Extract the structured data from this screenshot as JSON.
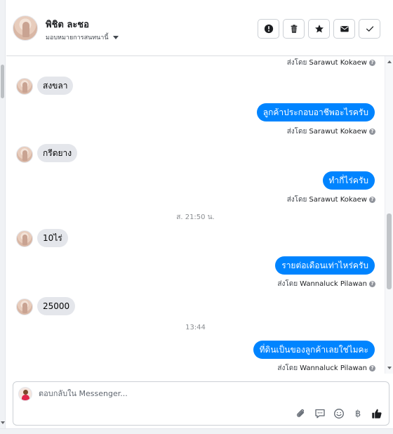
{
  "contact": {
    "name": "พิชิต ละชอ",
    "assign_label": "มอบหมายการสนทนานี้"
  },
  "actions": [
    {
      "icon": "alert-icon",
      "key": "mark-spam"
    },
    {
      "icon": "trash-icon",
      "key": "delete"
    },
    {
      "icon": "star-icon",
      "key": "star"
    },
    {
      "icon": "envelope-icon",
      "key": "mark-unread"
    },
    {
      "icon": "check-icon",
      "key": "mark-done"
    }
  ],
  "sent_by_prefix": "ส่งโดย",
  "messages": [
    {
      "type": "sentby",
      "agent": "Sarawut Kokaew"
    },
    {
      "type": "in",
      "text": "สงขลา"
    },
    {
      "type": "out",
      "text": "ลูกค้าประกอบอาชีพอะไรครับ"
    },
    {
      "type": "sentby",
      "agent": "Sarawut Kokaew"
    },
    {
      "type": "in",
      "text": "กรีดยาง"
    },
    {
      "type": "out",
      "text": "ทำกี่ไร่ครับ"
    },
    {
      "type": "sentby",
      "agent": "Sarawut Kokaew"
    },
    {
      "type": "timestamp",
      "text": "ส. 21:50 น."
    },
    {
      "type": "in",
      "text": "10ไร่"
    },
    {
      "type": "out",
      "text": "รายต่อเดือนเท่าไหร่ครับ"
    },
    {
      "type": "sentby",
      "agent": "Wannaluck Pilawan"
    },
    {
      "type": "in",
      "text": "25000"
    },
    {
      "type": "timestamp",
      "text": "13:44"
    },
    {
      "type": "out",
      "text": "ที่ดินเป็นของลูกค้าเลยใช่ไมคะ"
    },
    {
      "type": "sentby",
      "agent": "Wannaluck Pilawan"
    }
  ],
  "composer": {
    "placeholder": "ตอบกลับใน Messenger...",
    "tools": [
      "paperclip-icon",
      "saved-reply-icon",
      "emoji-icon",
      "baht-icon",
      "thumbs-up-icon"
    ],
    "baht_symbol": "฿"
  },
  "colors": {
    "outgoing_bubble": "#0084ff",
    "incoming_bubble": "#e4e6eb",
    "like_icon": "#1c1e21"
  }
}
